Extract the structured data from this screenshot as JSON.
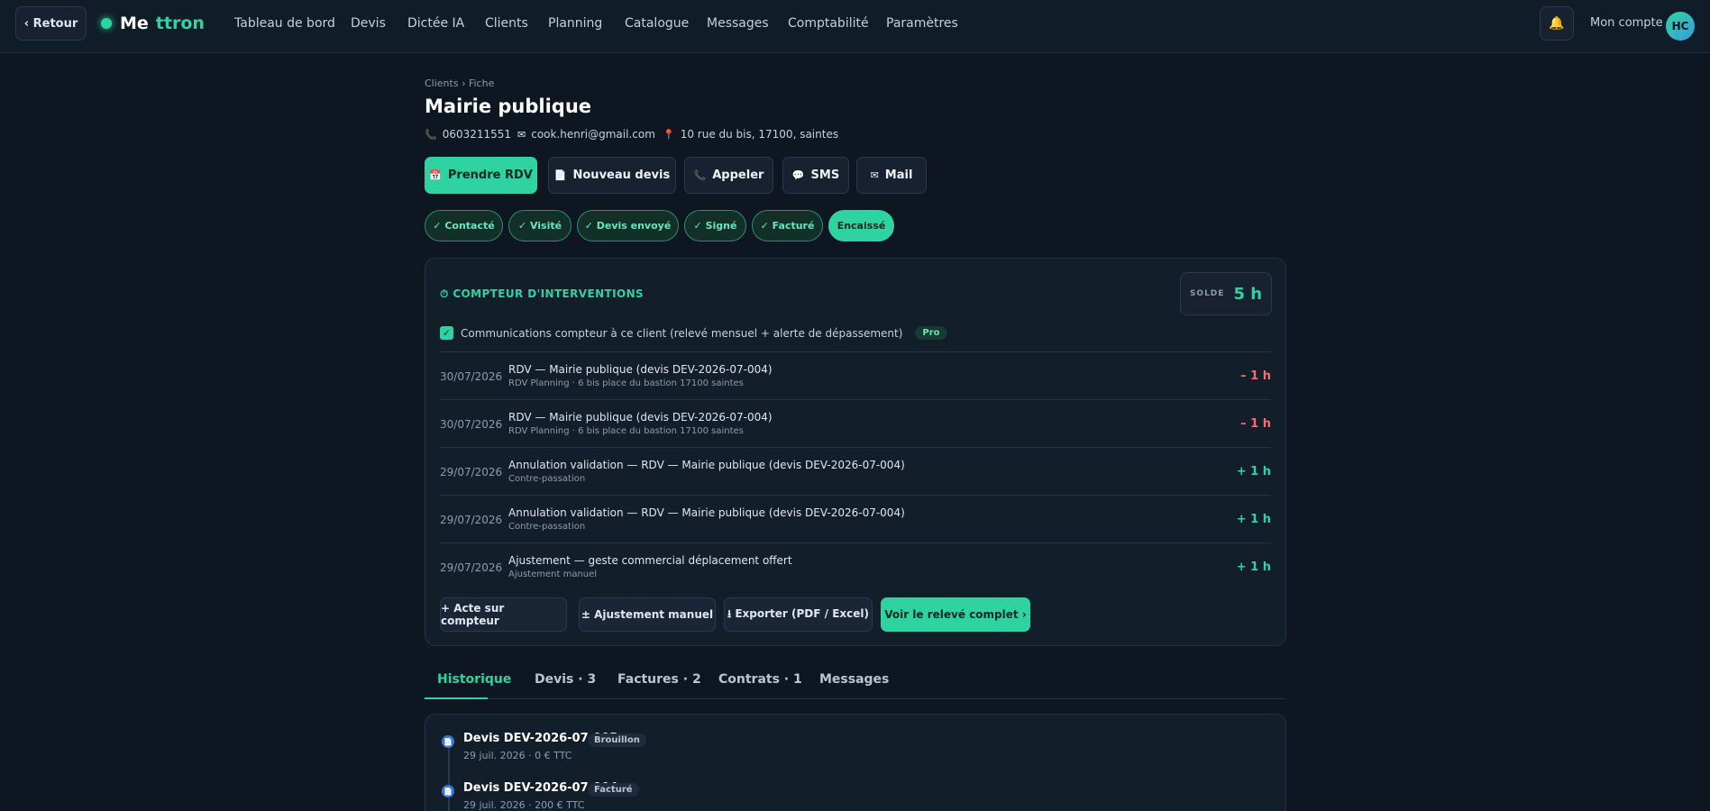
{
  "nav": {
    "back_label": "‹ Retour",
    "logo_part1": "Me",
    "logo_part2": "ttron",
    "items": [
      {
        "label": "Tableau de bord"
      },
      {
        "label": "Devis"
      },
      {
        "label": "Dictée IA"
      },
      {
        "label": "Clients"
      },
      {
        "label": "Planning"
      },
      {
        "label": "Catalogue"
      },
      {
        "label": "Messages"
      },
      {
        "label": "Comptabilité"
      },
      {
        "label": "Paramètres"
      }
    ],
    "bell_icon": "🔔",
    "account_label": "Mon compte",
    "avatar_initials": "HC"
  },
  "client": {
    "breadcrumb": "Clients › Fiche",
    "name": "Mairie publique",
    "phone": "0603211551",
    "email": "cook.henri@gmail.com",
    "address": "10 rue du bis, 17100, saintes"
  },
  "actions": [
    {
      "icon": "📅",
      "label": "Prendre RDV"
    },
    {
      "icon": "📄",
      "label": "Nouveau devis"
    },
    {
      "icon": "📞",
      "label": "Appeler"
    },
    {
      "icon": "💬",
      "label": "SMS"
    },
    {
      "icon": "✉",
      "label": "Mail"
    }
  ],
  "pipeline": [
    {
      "label": "✓ Contacté"
    },
    {
      "label": "✓ Visité"
    },
    {
      "label": "✓ Devis envoyé"
    },
    {
      "label": "✓ Signé"
    },
    {
      "label": "✓ Facturé"
    },
    {
      "label": "Encaissé"
    }
  ],
  "counter": {
    "title": "⏱ COMPTEUR D'INTERVENTIONS",
    "balance_label": "SOLDE",
    "balance_value": "5 h",
    "checkbox_label": "Communications compteur à ce client (relevé mensuel + alerte de dépassement)",
    "checkbox_checked": true,
    "pro_badge": "Pro",
    "entries": [
      {
        "date": "30/07/2026",
        "label": "RDV — Mairie publique (devis DEV-2026-07-004)",
        "sub": "RDV Planning · 6 bis place du bastion 17100 saintes",
        "amount": "– 1 h"
      },
      {
        "date": "30/07/2026",
        "label": "RDV — Mairie publique (devis DEV-2026-07-004)",
        "sub": "RDV Planning · 6 bis place du bastion 17100 saintes",
        "amount": "– 1 h"
      },
      {
        "date": "29/07/2026",
        "label": "Annulation validation — RDV — Mairie publique (devis DEV-2026-07-004)",
        "sub": "Contre-passation",
        "amount": "+ 1 h"
      },
      {
        "date": "29/07/2026",
        "label": "Annulation validation — RDV — Mairie publique (devis DEV-2026-07-004)",
        "sub": "Contre-passation",
        "amount": "+ 1 h"
      },
      {
        "date": "29/07/2026",
        "label": "Ajustement — geste commercial déplacement offert",
        "sub": "Ajustement manuel",
        "amount": "+ 1 h"
      }
    ],
    "buttons": [
      {
        "label": "+ Acte sur compteur"
      },
      {
        "label": "± Ajustement manuel"
      },
      {
        "label": "⭳ Exporter (PDF / Excel)"
      },
      {
        "label": "Voir le relevé complet ›"
      }
    ]
  },
  "tabs": [
    {
      "label": "Historique"
    },
    {
      "label": "Devis · 3"
    },
    {
      "label": "Factures · 2"
    },
    {
      "label": "Contrats · 1"
    },
    {
      "label": "Messages"
    }
  ],
  "history": [
    {
      "icon": "📄",
      "title": "Devis DEV-2026-07-005",
      "badge": "Brouillon",
      "sub": "29 juil. 2026 · 0 € TTC"
    },
    {
      "icon": "📄",
      "title": "Devis DEV-2026-07-004",
      "badge": "Facturé",
      "sub": "29 juil. 2026 · 200 € TTC"
    }
  ],
  "colors": {
    "accent": "#2fd3a2",
    "background": "#0d1621",
    "card": "#131e2b",
    "negative": "#ff6b6b"
  }
}
